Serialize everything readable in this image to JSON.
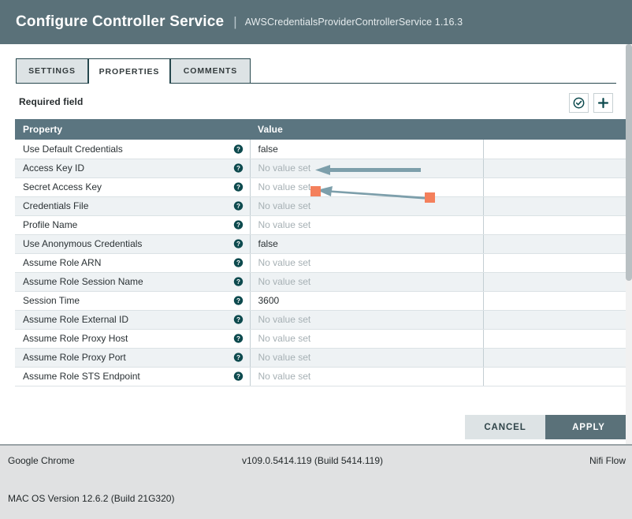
{
  "dialog": {
    "title": "Configure Controller Service",
    "separator": "|",
    "subtitle": "AWSCredentialsProviderControllerService 1.16.3",
    "tabs": [
      {
        "label": "SETTINGS",
        "active": false
      },
      {
        "label": "PROPERTIES",
        "active": true
      },
      {
        "label": "COMMENTS",
        "active": false
      }
    ],
    "required_field_label": "Required field",
    "toolbar": {
      "verify_icon": "check-circle-icon",
      "add_icon": "plus-icon"
    },
    "table": {
      "columns": [
        "Property",
        "Value",
        ""
      ],
      "empty_value_text": "No value set",
      "help_icon": "help-circle-icon",
      "rows": [
        {
          "property": "Use Default Credentials",
          "value": "false",
          "empty": false
        },
        {
          "property": "Access Key ID",
          "value": "No value set",
          "empty": true
        },
        {
          "property": "Secret Access Key",
          "value": "No value set",
          "empty": true
        },
        {
          "property": "Credentials File",
          "value": "No value set",
          "empty": true
        },
        {
          "property": "Profile Name",
          "value": "No value set",
          "empty": true
        },
        {
          "property": "Use Anonymous Credentials",
          "value": "false",
          "empty": false
        },
        {
          "property": "Assume Role ARN",
          "value": "No value set",
          "empty": true
        },
        {
          "property": "Assume Role Session Name",
          "value": "No value set",
          "empty": true
        },
        {
          "property": "Session Time",
          "value": "3600",
          "empty": false
        },
        {
          "property": "Assume Role External ID",
          "value": "No value set",
          "empty": true
        },
        {
          "property": "Assume Role Proxy Host",
          "value": "No value set",
          "empty": true
        },
        {
          "property": "Assume Role Proxy Port",
          "value": "No value set",
          "empty": true
        },
        {
          "property": "Assume Role STS Endpoint",
          "value": "No value set",
          "empty": true
        }
      ]
    },
    "buttons": {
      "cancel_label": "CANCEL",
      "apply_label": "APPLY"
    }
  },
  "infobar": {
    "browser": "Google Chrome",
    "version": "v109.0.5414.119 (Build 5414.119)",
    "app": "Nifi Flow",
    "os": "MAC OS Version 12.6.2 (Build 21G320)"
  },
  "annotations": {
    "arrow_color": "#7d9fab",
    "handle_color": "#f4805c",
    "arrow_one": {
      "name": "pointer-arrow-access-key-id"
    },
    "arrow_two": {
      "name": "pointer-arrow-secret-access-key-selected"
    }
  },
  "colors": {
    "header_bg": "#5a7179",
    "table_header_bg": "#5b7580",
    "apply_bg": "#5a7179",
    "cancel_bg": "#dde3e5",
    "row_alt_bg": "#eef2f4",
    "accent_teal": "#0d4a4e"
  }
}
